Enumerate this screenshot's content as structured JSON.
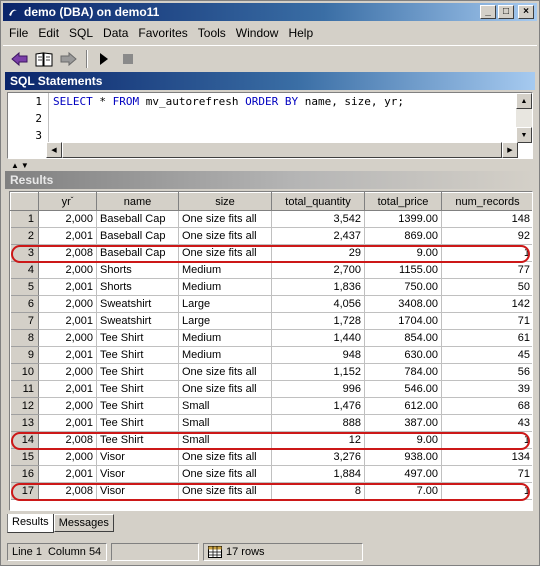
{
  "window": {
    "title": "demo (DBA) on demo11",
    "icon": "sybase-icon",
    "controls": {
      "minimize": "_",
      "maximize": "□",
      "close": "×"
    }
  },
  "menu": [
    "File",
    "Edit",
    "SQL",
    "Data",
    "Favorites",
    "Tools",
    "Window",
    "Help"
  ],
  "toolbar": [
    "back-arrow-icon",
    "open-book-icon",
    "forward-arrow-icon",
    "execute-icon",
    "stop-icon"
  ],
  "sql_panel": {
    "title": "SQL Statements",
    "line_numbers": [
      "1",
      "2",
      "3"
    ],
    "code": {
      "kw1": "SELECT",
      "p1": " * ",
      "kw2": "FROM",
      "p2": " mv_autorefresh ",
      "kw3": "ORDER BY",
      "p3": " name, size, yr;"
    }
  },
  "results_panel": {
    "title": "Results",
    "columns": [
      "yr",
      "name",
      "size",
      "total_quantity",
      "total_price",
      "num_records"
    ],
    "rows": [
      {
        "n": "1",
        "yr": "2,000",
        "name": "Baseball Cap",
        "size": "One size fits all",
        "total_quantity": "3,542",
        "total_price": "1399.00",
        "num_records": "148",
        "highlight": false
      },
      {
        "n": "2",
        "yr": "2,001",
        "name": "Baseball Cap",
        "size": "One size fits all",
        "total_quantity": "2,437",
        "total_price": "869.00",
        "num_records": "92",
        "highlight": false
      },
      {
        "n": "3",
        "yr": "2,008",
        "name": "Baseball Cap",
        "size": "One size fits all",
        "total_quantity": "29",
        "total_price": "9.00",
        "num_records": "1",
        "highlight": true
      },
      {
        "n": "4",
        "yr": "2,000",
        "name": "Shorts",
        "size": "Medium",
        "total_quantity": "2,700",
        "total_price": "1155.00",
        "num_records": "77",
        "highlight": false
      },
      {
        "n": "5",
        "yr": "2,001",
        "name": "Shorts",
        "size": "Medium",
        "total_quantity": "1,836",
        "total_price": "750.00",
        "num_records": "50",
        "highlight": false
      },
      {
        "n": "6",
        "yr": "2,000",
        "name": "Sweatshirt",
        "size": "Large",
        "total_quantity": "4,056",
        "total_price": "3408.00",
        "num_records": "142",
        "highlight": false
      },
      {
        "n": "7",
        "yr": "2,001",
        "name": "Sweatshirt",
        "size": "Large",
        "total_quantity": "1,728",
        "total_price": "1704.00",
        "num_records": "71",
        "highlight": false
      },
      {
        "n": "8",
        "yr": "2,000",
        "name": "Tee Shirt",
        "size": "Medium",
        "total_quantity": "1,440",
        "total_price": "854.00",
        "num_records": "61",
        "highlight": false
      },
      {
        "n": "9",
        "yr": "2,001",
        "name": "Tee Shirt",
        "size": "Medium",
        "total_quantity": "948",
        "total_price": "630.00",
        "num_records": "45",
        "highlight": false
      },
      {
        "n": "10",
        "yr": "2,000",
        "name": "Tee Shirt",
        "size": "One size fits all",
        "total_quantity": "1,152",
        "total_price": "784.00",
        "num_records": "56",
        "highlight": false
      },
      {
        "n": "11",
        "yr": "2,001",
        "name": "Tee Shirt",
        "size": "One size fits all",
        "total_quantity": "996",
        "total_price": "546.00",
        "num_records": "39",
        "highlight": false
      },
      {
        "n": "12",
        "yr": "2,000",
        "name": "Tee Shirt",
        "size": "Small",
        "total_quantity": "1,476",
        "total_price": "612.00",
        "num_records": "68",
        "highlight": false
      },
      {
        "n": "13",
        "yr": "2,001",
        "name": "Tee Shirt",
        "size": "Small",
        "total_quantity": "888",
        "total_price": "387.00",
        "num_records": "43",
        "highlight": false
      },
      {
        "n": "14",
        "yr": "2,008",
        "name": "Tee Shirt",
        "size": "Small",
        "total_quantity": "12",
        "total_price": "9.00",
        "num_records": "1",
        "highlight": true
      },
      {
        "n": "15",
        "yr": "2,000",
        "name": "Visor",
        "size": "One size fits all",
        "total_quantity": "3,276",
        "total_price": "938.00",
        "num_records": "134",
        "highlight": false
      },
      {
        "n": "16",
        "yr": "2,001",
        "name": "Visor",
        "size": "One size fits all",
        "total_quantity": "1,884",
        "total_price": "497.00",
        "num_records": "71",
        "highlight": false
      },
      {
        "n": "17",
        "yr": "2,008",
        "name": "Visor",
        "size": "One size fits all",
        "total_quantity": "8",
        "total_price": "7.00",
        "num_records": "1",
        "highlight": true
      }
    ],
    "tabs": [
      "Results",
      "Messages"
    ],
    "active_tab": "Results"
  },
  "highlight_color": "#cc1818",
  "status": {
    "line": "Line 1",
    "column": "Column 54",
    "rows": "17 rows"
  }
}
